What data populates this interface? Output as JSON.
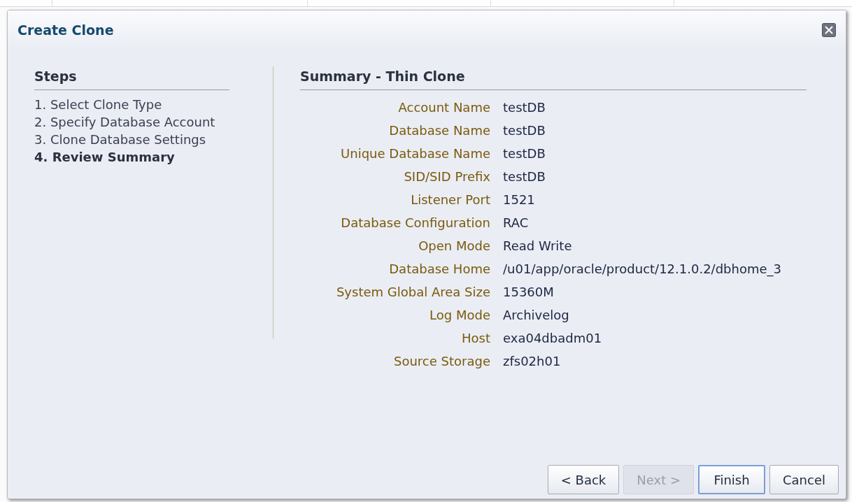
{
  "dialog": {
    "title": "Create Clone"
  },
  "steps": {
    "heading": "Steps",
    "items": [
      {
        "label": "1. Select Clone Type",
        "selected": false
      },
      {
        "label": "2. Specify Database Account",
        "selected": false
      },
      {
        "label": "3. Clone Database Settings",
        "selected": false
      },
      {
        "label": "4. Review Summary",
        "selected": true
      }
    ]
  },
  "summary": {
    "heading": "Summary - Thin Clone",
    "fields": [
      {
        "label": "Account Name",
        "value": "testDB"
      },
      {
        "label": "Database Name",
        "value": "testDB"
      },
      {
        "label": "Unique Database Name",
        "value": "testDB"
      },
      {
        "label": "SID/SID Prefix",
        "value": "testDB"
      },
      {
        "label": "Listener Port",
        "value": "1521"
      },
      {
        "label": "Database Configuration",
        "value": "RAC"
      },
      {
        "label": "Open Mode",
        "value": "Read Write"
      },
      {
        "label": "Database Home",
        "value": "/u01/app/oracle/product/12.1.0.2/dbhome_3"
      },
      {
        "label": "System Global Area Size",
        "value": "15360M"
      },
      {
        "label": "Log Mode",
        "value": "Archivelog"
      },
      {
        "label": "Host",
        "value": "exa04dbadm01"
      },
      {
        "label": "Source Storage",
        "value": "zfs02h01"
      }
    ]
  },
  "buttons": [
    {
      "label": "< Back",
      "disabled": false,
      "selected": false
    },
    {
      "label": "Next >",
      "disabled": true,
      "selected": false
    },
    {
      "label": "Finish",
      "disabled": false,
      "selected": true
    },
    {
      "label": "Cancel",
      "disabled": false,
      "selected": false
    }
  ]
}
